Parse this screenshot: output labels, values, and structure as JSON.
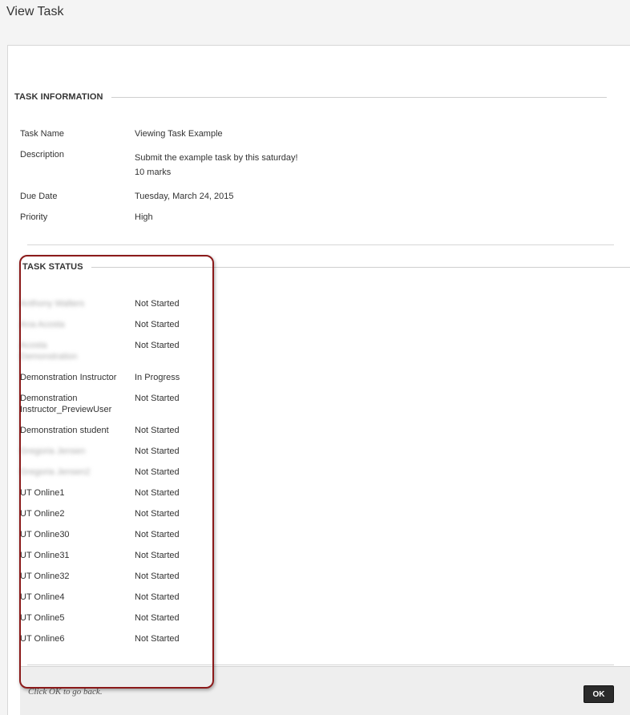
{
  "window": {
    "title": "View Task"
  },
  "task_information": {
    "heading": "TASK INFORMATION",
    "task_name_label": "Task Name",
    "task_name_value": "Viewing Task Example",
    "description_label": "Description",
    "description_line1": "Submit the example task by this saturday!",
    "description_line2": "10 marks",
    "due_date_label": "Due Date",
    "due_date_value": "Tuesday, March 24, 2015",
    "priority_label": "Priority",
    "priority_value": "High"
  },
  "task_status": {
    "heading": "TASK STATUS",
    "rows": [
      {
        "name": "Anthony Walters",
        "status": "Not Started",
        "blurred": true
      },
      {
        "name": "Ana Acosta",
        "status": "Not Started",
        "blurred": true
      },
      {
        "name": "Acosta",
        "name_line2": "Demonstration",
        "status": "Not Started",
        "blurred": true
      },
      {
        "name": "Demonstration Instructor",
        "status": "In Progress",
        "blurred": false
      },
      {
        "name": "Demonstration",
        "name_line2": "Instructor_PreviewUser",
        "status": "Not Started",
        "blurred": false
      },
      {
        "name": "Demonstration student",
        "status": "Not Started",
        "blurred": false
      },
      {
        "name": "Gregoria Jensen",
        "status": "Not Started",
        "blurred": true
      },
      {
        "name": "Gregoria Jensen2",
        "status": "Not Started",
        "blurred": true
      },
      {
        "name": "UT Online1",
        "status": "Not Started",
        "blurred": false
      },
      {
        "name": "UT Online2",
        "status": "Not Started",
        "blurred": false
      },
      {
        "name": "UT Online30",
        "status": "Not Started",
        "blurred": false
      },
      {
        "name": "UT Online31",
        "status": "Not Started",
        "blurred": false
      },
      {
        "name": "UT Online32",
        "status": "Not Started",
        "blurred": false
      },
      {
        "name": "UT Online4",
        "status": "Not Started",
        "blurred": false
      },
      {
        "name": "UT Online5",
        "status": "Not Started",
        "blurred": false
      },
      {
        "name": "UT Online6",
        "status": "Not Started",
        "blurred": false
      }
    ]
  },
  "footer": {
    "hint": "Click OK to go back.",
    "ok_label": "OK"
  },
  "colors": {
    "highlight": "#8b1a1a",
    "button": "#2b2b2b"
  }
}
